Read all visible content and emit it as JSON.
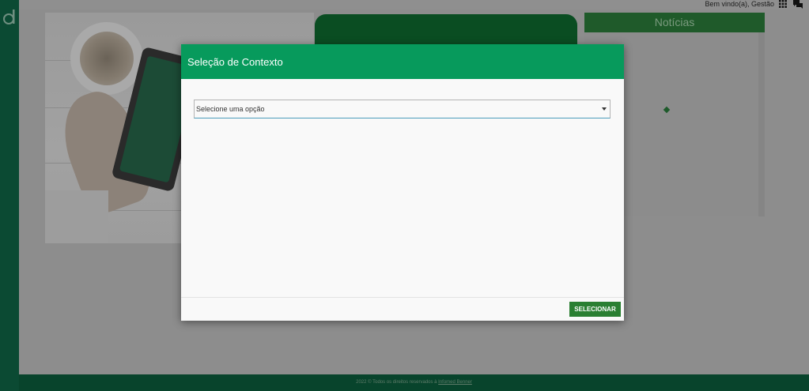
{
  "header": {
    "welcome_text": "Bem vindo(a), Gestão",
    "icons": [
      "apps-grid-icon",
      "chat-icon"
    ]
  },
  "news": {
    "title": "Notícias"
  },
  "modal": {
    "title": "Seleção de Contexto",
    "select_placeholder": "Selecione uma opção",
    "submit_label": "SELECIONAR"
  },
  "footer": {
    "text": "2022 © Todos os direitos reservados à",
    "link": "Infomed Benner"
  },
  "colors": {
    "modal_header": "#079a5c",
    "button": "#2a7f32",
    "sidebar": "#0b4a33",
    "footer": "#08442c"
  }
}
